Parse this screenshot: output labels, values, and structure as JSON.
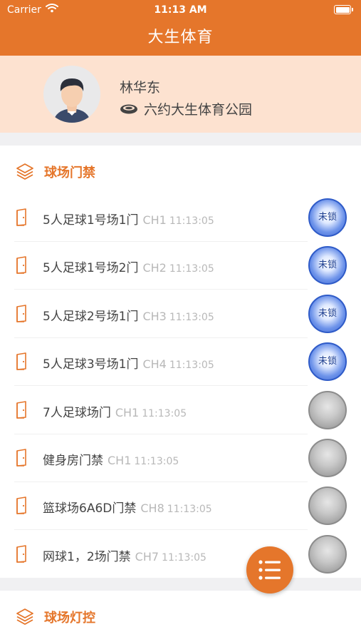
{
  "status_bar": {
    "carrier": "Carrier",
    "time": "11:13 AM"
  },
  "header": {
    "title": "大生体育"
  },
  "profile": {
    "name": "林华东",
    "venue": "六约大生体育公园"
  },
  "sections": [
    {
      "label": "球场门禁",
      "icon": "layers-icon"
    },
    {
      "label": "球场灯控",
      "icon": "layers-icon"
    }
  ],
  "doors": [
    {
      "name": "5人足球1号场1门",
      "channel": "CH1",
      "time": "11:13:05",
      "state": "unlocked",
      "lock_label": "未锁"
    },
    {
      "name": "5人足球1号场2门",
      "channel": "CH2",
      "time": "11:13:05",
      "state": "unlocked",
      "lock_label": "未锁"
    },
    {
      "name": "5人足球2号场1门",
      "channel": "CH3",
      "time": "11:13:05",
      "state": "unlocked",
      "lock_label": "未锁"
    },
    {
      "name": "5人足球3号场1门",
      "channel": "CH4",
      "time": "11:13:05",
      "state": "unlocked",
      "lock_label": "未锁"
    },
    {
      "name": "7人足球场门",
      "channel": "CH1",
      "time": "11:13:05",
      "state": "offline",
      "lock_label": ""
    },
    {
      "name": "健身房门禁",
      "channel": "CH1",
      "time": "11:13:05",
      "state": "offline",
      "lock_label": ""
    },
    {
      "name": "篮球场6A6D门禁",
      "channel": "CH8",
      "time": "11:13:05",
      "state": "offline",
      "lock_label": ""
    },
    {
      "name": "网球1，2场门禁",
      "channel": "CH7",
      "time": "11:13:05",
      "state": "offline",
      "lock_label": ""
    }
  ],
  "colors": {
    "accent": "#e5762b",
    "profile_bg": "#fde2d0",
    "lock_blue": "#3b64cf",
    "lock_gray": "#9c9c9c"
  },
  "fab": {
    "icon": "list-menu-icon"
  }
}
